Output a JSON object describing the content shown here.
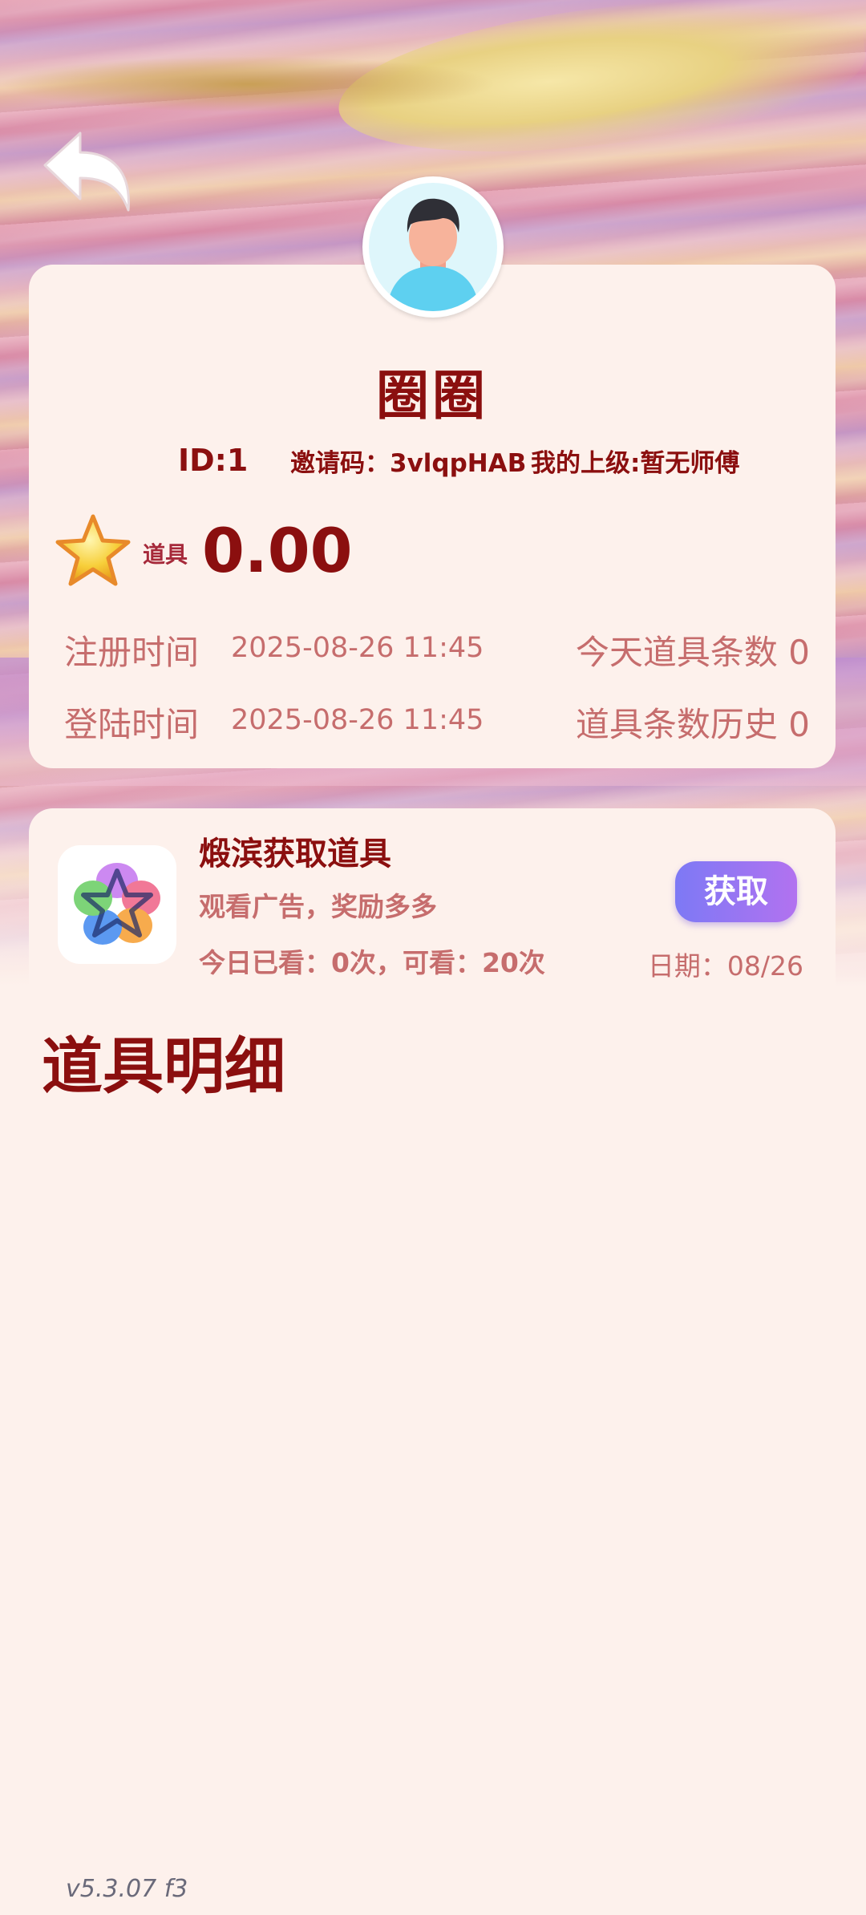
{
  "header": {
    "back_icon": "back-arrow-icon",
    "avatar_icon": "user-avatar-icon"
  },
  "profile": {
    "username": "圈圈",
    "id": "ID:1",
    "invite_code": "邀请码：3vlqpHAB",
    "parent": "我的上级:暂无师傅",
    "prop_label": "道具",
    "prop_value": "0.00",
    "register_label": "注册时间",
    "register_time": "2025-08-26 11:45",
    "login_label": "登陆时间",
    "login_time": "2025-08-26 11:45",
    "today_label": "今天道具条数",
    "today_value": "0",
    "history_label": "道具条数历史",
    "history_value": "0"
  },
  "task": {
    "title": "煅滨获取道具",
    "subtitle": "观看广告，奖励多多",
    "count": "今日已看：0次，可看：20次",
    "button": "获取",
    "date": "日期：08/26"
  },
  "details": {
    "title": "道具明细"
  },
  "footer": {
    "version": "v5.3.07 f3"
  },
  "colors": {
    "primary_text": "#8b0f0f",
    "secondary_text": "#c66d6d",
    "button_start": "#7d79f5",
    "button_end": "#b272f0",
    "card_bg": "#fdf1ec"
  }
}
